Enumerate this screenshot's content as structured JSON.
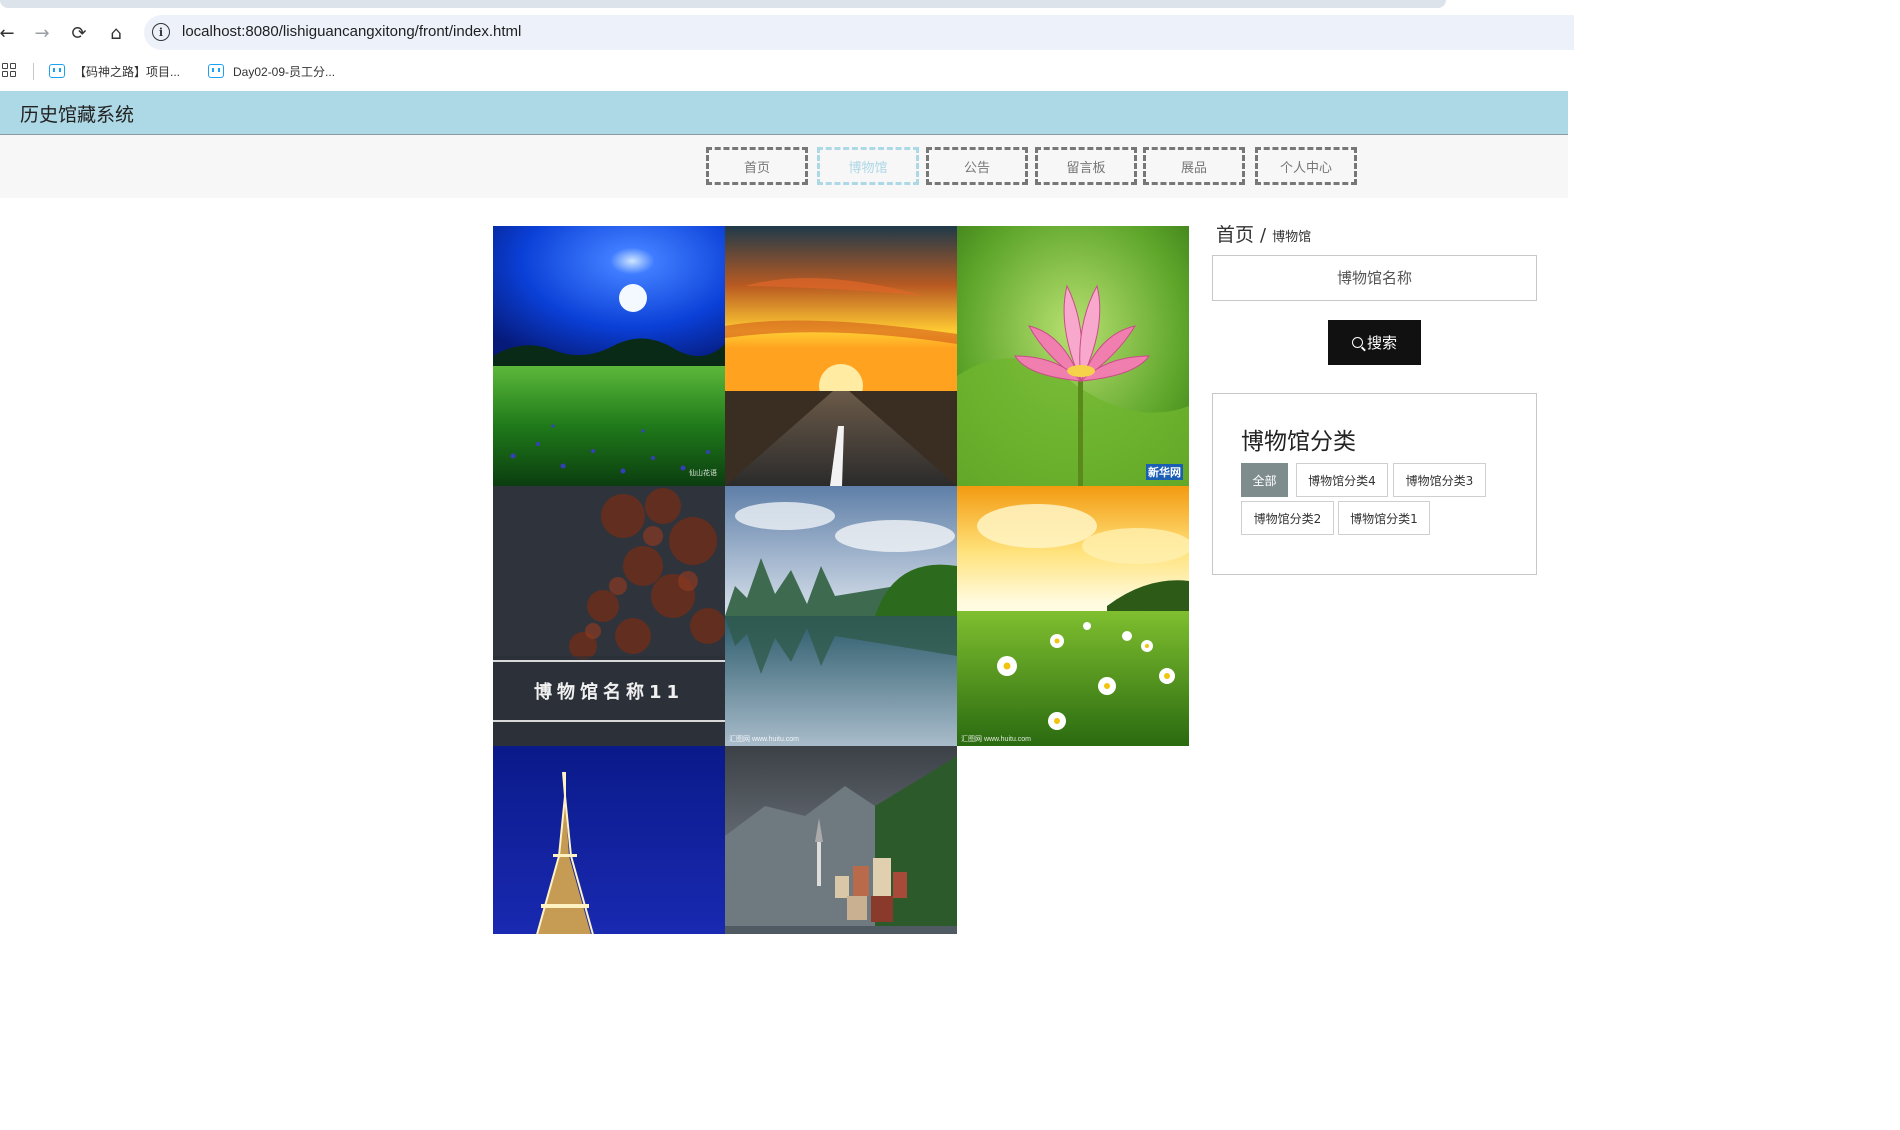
{
  "browser": {
    "url": "localhost:8080/lishiguancangxitong/front/index.html",
    "back_icon": "←",
    "forward_icon": "→",
    "reload_icon": "⟳",
    "home_icon": "⌂",
    "info_icon": "i",
    "bookmarks": [
      {
        "label": "【码神之路】项目..."
      },
      {
        "label": "Day02-09-员工分..."
      }
    ]
  },
  "site": {
    "title": "历史馆藏系统",
    "nav": [
      {
        "label": "首页"
      },
      {
        "label": "博物馆"
      },
      {
        "label": "公告"
      },
      {
        "label": "留言板"
      },
      {
        "label": "展品"
      },
      {
        "label": "个人中心"
      }
    ],
    "active_nav": "博物馆",
    "accent_color": "#add8e6"
  },
  "breadcrumb": {
    "home": "首页",
    "separator": "/",
    "current": "博物馆"
  },
  "search": {
    "placeholder": "博物馆名称",
    "button_label": "搜索"
  },
  "category": {
    "title": "博物馆分类",
    "tags": [
      {
        "label": "全部",
        "active": true
      },
      {
        "label": "博物馆分类4",
        "active": false
      },
      {
        "label": "博物馆分类3",
        "active": false
      },
      {
        "label": "博物馆分类2",
        "active": false
      },
      {
        "label": "博物馆分类1",
        "active": false
      }
    ]
  },
  "gallery": {
    "items": [
      {
        "scene": "moonlit-meadow",
        "watermark": "仙山花语"
      },
      {
        "scene": "sunset-road"
      },
      {
        "scene": "lotus-flower",
        "watermark": "新华网"
      },
      {
        "scene": "autumn-leaves-title",
        "caption": "博物馆名称11"
      },
      {
        "scene": "karst-lake-reflection",
        "watermark": "汇图网 www.huitu.com"
      },
      {
        "scene": "daisy-field",
        "watermark": "汇图网 www.huitu.com"
      },
      {
        "scene": "eiffel-tower-night"
      },
      {
        "scene": "lakeside-village"
      }
    ]
  }
}
